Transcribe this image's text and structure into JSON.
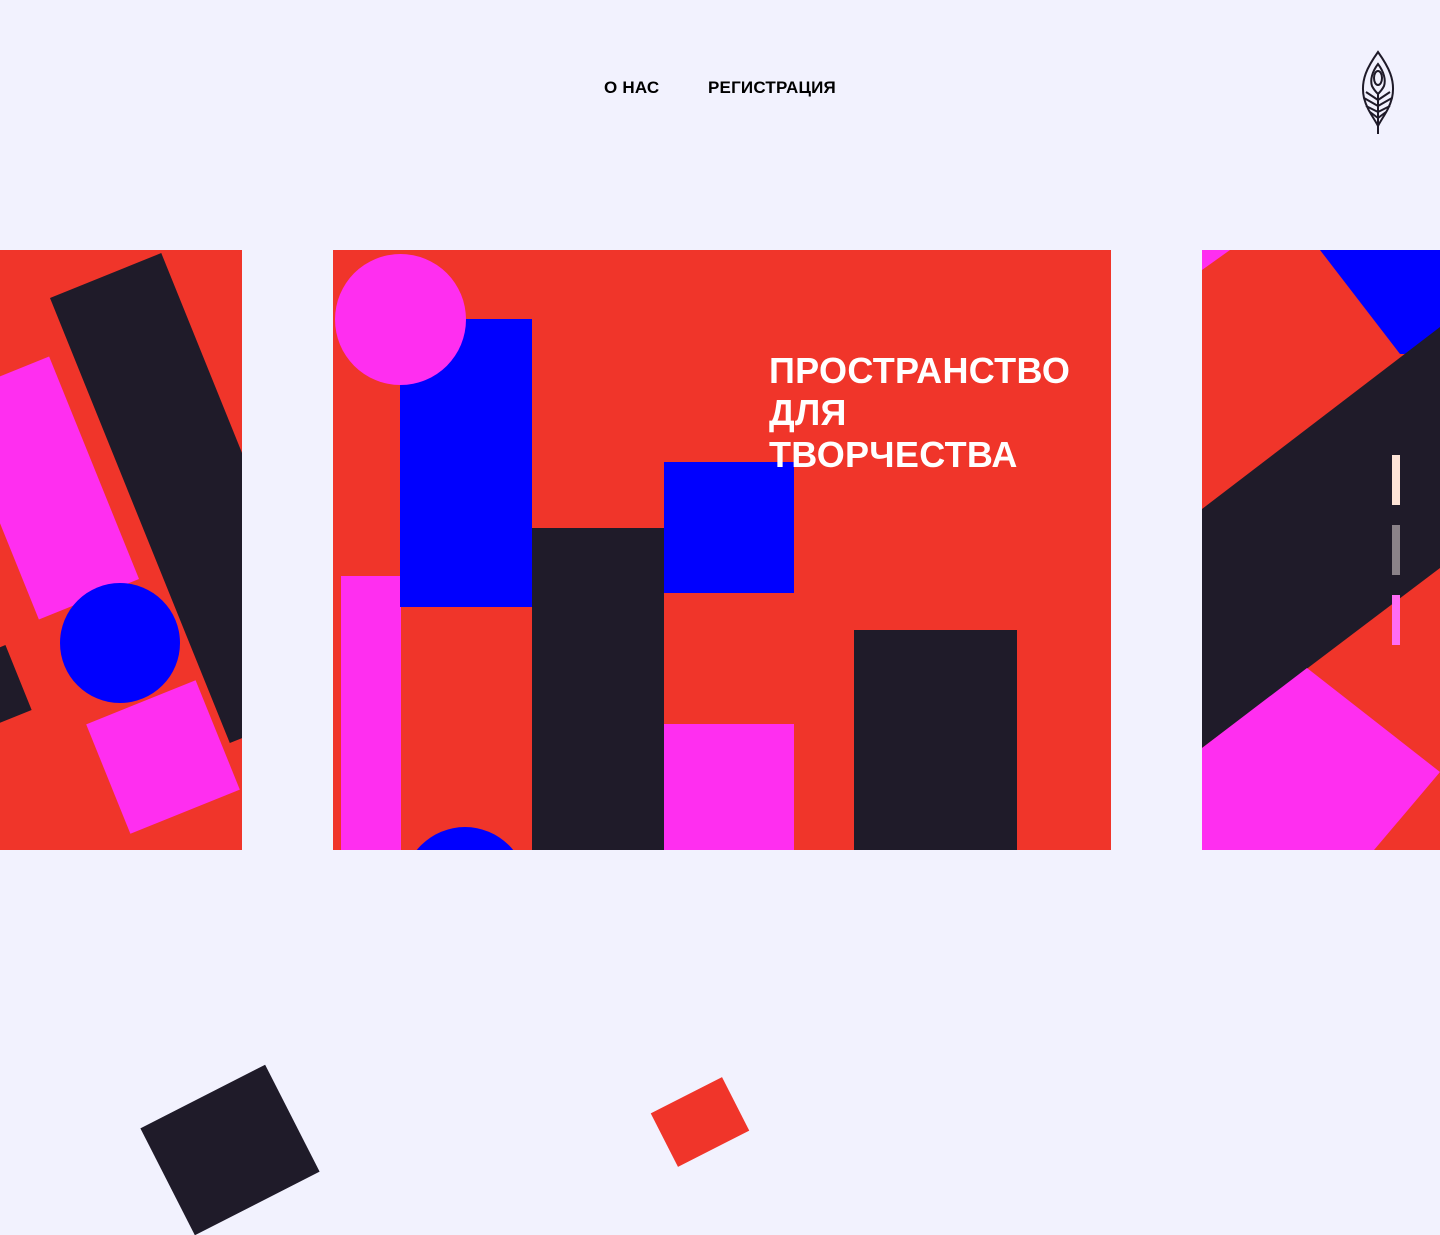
{
  "nav": {
    "about": "О НАС",
    "registration": "РЕГИСТРАЦИЯ"
  },
  "logo": {
    "icon": "feather-icon",
    "color": "#1f1b29"
  },
  "hero": {
    "title_lines": [
      "ПРОСТРАНСТВО",
      "ДЛЯ",
      "ТВОРЧЕСТВА"
    ]
  },
  "slider": {
    "slide_count": 3,
    "active_index": 0,
    "indicator_colors": [
      "#fde3d6",
      "#8a8288",
      "#ff6cf5"
    ]
  },
  "colors": {
    "background": "#f2f2fe",
    "red": "#f0352a",
    "magenta": "#ff2ef0",
    "blue": "#0000ff",
    "dark": "#1f1b29"
  }
}
